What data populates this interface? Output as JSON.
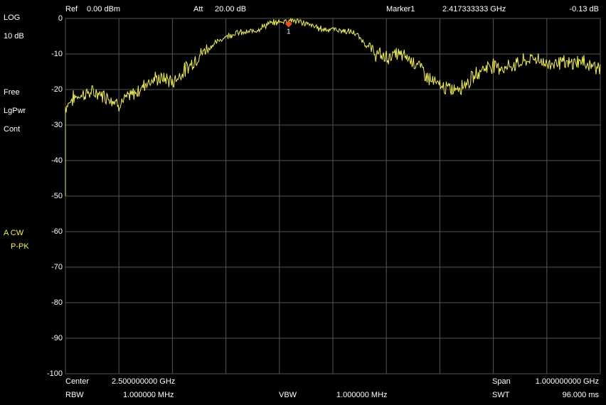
{
  "header": {
    "ref_label": "Ref",
    "ref_value": "0.00 dBm",
    "att_label": "Att",
    "att_value": "20.00 dB",
    "marker_label": "Marker1",
    "marker_freq": "2.417333333 GHz",
    "marker_level": "-0.13 dB"
  },
  "side": {
    "scale_mode": "LOG",
    "scale_div": "10 dB",
    "trigger": "Free",
    "detector": "LgPwr",
    "sweep_mode": "Cont",
    "trace_label": "A CW",
    "trace_detector": "P-PK"
  },
  "footer": {
    "center_label": "Center",
    "center_value": "2.500000000 GHz",
    "span_label": "Span",
    "span_value": "1.000000000 GHz",
    "rbw_label": "RBW",
    "rbw_value": "1.000000 MHz",
    "vbw_label": "VBW",
    "vbw_value": "1.000000 MHz",
    "swt_label": "SWT",
    "swt_value": "96.000 ms"
  },
  "marker": {
    "label": "1",
    "x_ghz": 2.417333333,
    "y_db": -0.13
  },
  "colors": {
    "trace": "#f2f05a",
    "grid": "#555555",
    "marker": "#e0502a",
    "background": "#000000"
  },
  "chart_data": {
    "type": "line",
    "xlim": [
      2.0,
      3.0
    ],
    "ylim": [
      -100,
      0
    ],
    "yticks": [
      "0",
      "-10",
      "-20",
      "-30",
      "-40",
      "-50",
      "-60",
      "-70",
      "-80",
      "-90",
      "-100"
    ],
    "grid": true,
    "series": [
      {
        "x": [
          2.0,
          2.01,
          2.02,
          2.04,
          2.06,
          2.08,
          2.1,
          2.12,
          2.14,
          2.15,
          2.17,
          2.19,
          2.2,
          2.22,
          2.24,
          2.26,
          2.28,
          2.3,
          2.32,
          2.34,
          2.36,
          2.38,
          2.4,
          2.42,
          2.44,
          2.46,
          2.48,
          2.5,
          2.52,
          2.54,
          2.56,
          2.58,
          2.6,
          2.62,
          2.64,
          2.66,
          2.68,
          2.7,
          2.72,
          2.74,
          2.76,
          2.78,
          2.8,
          2.82,
          2.84,
          2.86,
          2.88,
          2.9,
          2.92,
          2.94,
          2.96,
          2.98,
          3.0
        ],
        "values": [
          -25,
          -23,
          -22,
          -21,
          -21,
          -22,
          -24,
          -22,
          -20,
          -18,
          -17,
          -17,
          -18,
          -15,
          -12,
          -9,
          -7,
          -5,
          -4,
          -4,
          -3,
          -1.5,
          -1,
          -0.3,
          -1,
          -2,
          -3,
          -3,
          -3.5,
          -4,
          -7,
          -10,
          -11,
          -10,
          -11,
          -13,
          -17,
          -19,
          -20,
          -19,
          -17,
          -14,
          -13,
          -14,
          -13,
          -12,
          -11,
          -13,
          -12,
          -13,
          -12,
          -13,
          -14
        ]
      }
    ]
  }
}
